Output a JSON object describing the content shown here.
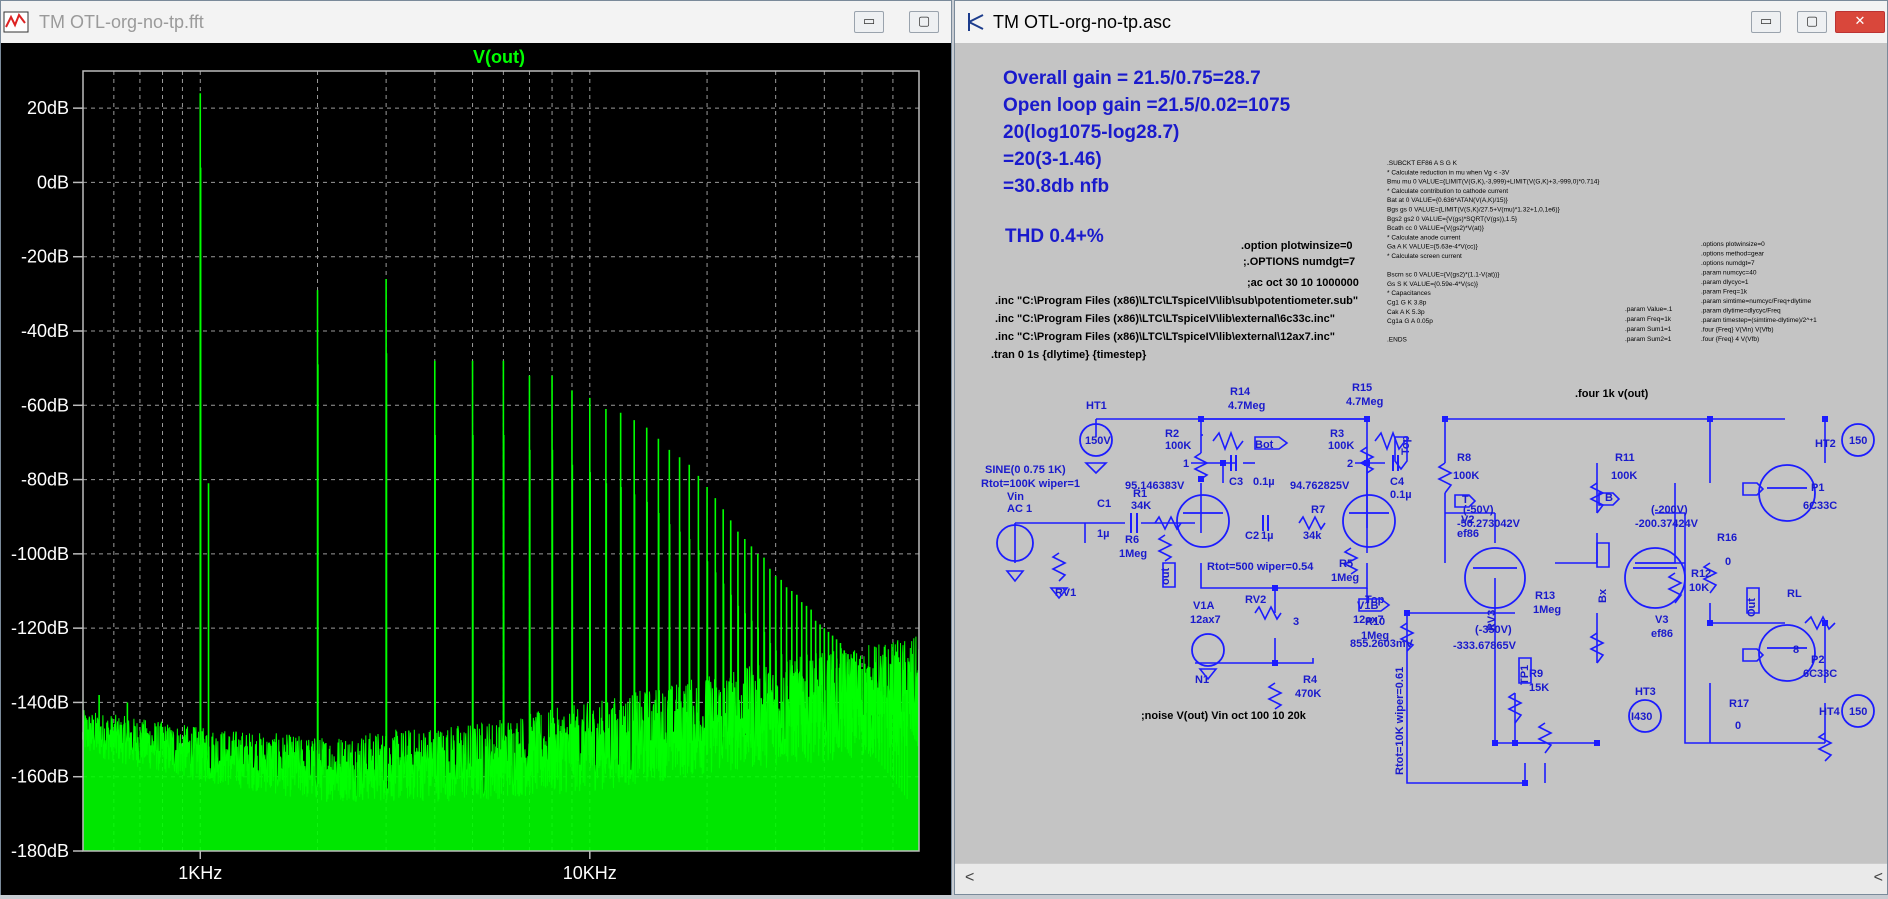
{
  "plot_window": {
    "title": "TM OTL-org-no-tp.fft",
    "buttons": {
      "minimize": "▭",
      "maximize": "▢"
    }
  },
  "schematic_window": {
    "title": "TM OTL-org-no-tp.asc",
    "buttons": {
      "minimize": "▭",
      "maximize": "▢",
      "close": "✕"
    },
    "scroll_left": "<",
    "scroll_right": "<"
  },
  "colors": {
    "trace": "#00ff00",
    "wire": "#1c1cff",
    "plot_bg": "#000000",
    "schem_bg": "#c4c4c4"
  },
  "chart_data": {
    "type": "line",
    "title": "V(out)",
    "xscale": "log",
    "xlim": [
      500,
      70000
    ],
    "ylim": [
      -180,
      30
    ],
    "grid": true,
    "ytick_labels": [
      "20dB",
      "0dB",
      "-20dB",
      "-40dB",
      "-60dB",
      "-80dB",
      "-100dB",
      "-120dB",
      "-140dB",
      "-160dB",
      "-180dB"
    ],
    "ytick_values": [
      20,
      0,
      -20,
      -40,
      -60,
      -80,
      -100,
      -120,
      -140,
      -160,
      -180
    ],
    "xtick_labels": [
      "1KHz",
      "10KHz"
    ],
    "xtick_values": [
      1000,
      10000
    ],
    "harmonics": {
      "fundamental_hz": 1000,
      "levels_db": [
        24,
        -29,
        -26,
        -48,
        -48,
        -48,
        -52,
        -52,
        -56,
        -58,
        -61,
        -62,
        -64,
        -66,
        -69,
        -72,
        -74,
        -76,
        -79,
        -82,
        -85,
        -88,
        -91,
        -94,
        -96,
        -98,
        -100,
        -101,
        -104,
        -106,
        -107,
        -109,
        -110,
        -111,
        -113,
        -114,
        -115,
        -118,
        -119,
        -120,
        -121,
        -122,
        -123,
        -124,
        -126,
        -127,
        -128,
        -129,
        -130,
        -131,
        -132,
        -133,
        -134,
        -135,
        -136,
        -137,
        -138,
        -139,
        -140,
        -141,
        -142,
        -143,
        -144,
        -145,
        -146
      ]
    },
    "spurs": [
      {
        "f": 550,
        "db": -138
      },
      {
        "f": 500,
        "db": -150
      },
      {
        "f": 650,
        "db": -140
      },
      {
        "f": 1050,
        "db": -81
      }
    ],
    "noise_floor": [
      {
        "f": 500,
        "db": -148
      },
      {
        "f": 1000,
        "db": -154
      },
      {
        "f": 2000,
        "db": -158
      },
      {
        "f": 5000,
        "db": -156
      },
      {
        "f": 10000,
        "db": -152
      },
      {
        "f": 20000,
        "db": -146
      },
      {
        "f": 40000,
        "db": -141
      },
      {
        "f": 70000,
        "db": -138
      }
    ]
  },
  "schematic": {
    "notes": {
      "gain1": "Overall gain = 21.5/0.75=28.7",
      "gain2": "Open loop gain =21.5/0.02=1075",
      "gain3": "20(log1075-log28.7)",
      "gain4": "=20(3-1.46)",
      "gain5": "=30.8db nfb",
      "thd": "THD 0.4+%"
    },
    "directives": {
      "opt1": ".option plotwinsize=0",
      "opt2": ";.OPTIONS numdgt=7",
      "ac": ";ac oct 30 10 1000000",
      "inc1": ".inc \"C:\\Program Files (x86)\\LTC\\LTspiceIV\\lib\\sub\\potentiometer.sub\"",
      "inc2": ".inc \"C:\\Program Files (x86)\\LTC\\LTspiceIV\\lib\\external\\6c33c.inc\"",
      "inc3": ".inc \"C:\\Program Files (x86)\\LTC\\LTspiceIV\\lib\\external\\12ax7.inc\"",
      "tran": ".tran 0 1s {dlytime} {timestep}",
      "four": ".four 1k v(out)",
      "noise": ";noise V(out) Vin oct 100 10 20k"
    },
    "subckt_lines": [
      ".SUBCKT EF86 A S G K",
      "* Calculate reduction in mu when Vg < -3V",
      "Bmu  mu  0  VALUE={LIMIT(V(G,K),-3,999)+LIMIT(V(G,K)+3,-999,0)*0.714}",
      "* Calculate contribution to cathode current",
      "Bat  at  0  VALUE={0.636*ATAN(V(A,K)/15)}",
      "Bgs  gs  0  VALUE={LIMIT(V(S,K)/27.5+V(mu)*1.32+1,0,1e6)}",
      "Bgs2  gs2  0  VALUE={V(gs)*SQRT(V(gs)),1.5}",
      "Bcath  cc  0  VALUE={V(gs2)*V(at)}",
      "* Calculate anode current",
      "Ga  A  K  VALUE={5.63e-4*V(cc)}",
      "* Calculate screen current",
      "",
      "Bscrn  sc  0  VALUE={V(gs2)*(1.1-V(at))}",
      "Gs  S  K  VALUE={0.59e-4*V(sc)}",
      "* Capacitances",
      "Cg1  G  K  3.8p",
      "Cak  A  K  5.3p",
      "Cg1a  G  A  0.05p",
      "",
      ".ENDS"
    ],
    "options_lines": [
      ".options plotwinsize=0",
      ".options method=gear",
      ".options numdgt=7",
      ".param numcyc=40",
      ".param dlycyc=1",
      ".param Freq=1k",
      ".param simtime=numcyc/Freq+dlytime",
      ".param dlytime=dlycyc/Freq",
      ".param timestep=(simtime-dlytime)/2^+1",
      ".four {Freq} V(Vin) V(Vfb)",
      ".four {Freq} 4 V(Vfb)"
    ],
    "param_lines": [
      ".param Value=.1",
      ".param Freq=1k",
      ".param Sum1=1",
      ".param Sum2=1"
    ],
    "labels": {
      "HT1": "HT1",
      "HT1v": "150V",
      "R2": "R2",
      "R2v": "100K",
      "R14": "R14",
      "R14v": "4.7Meg",
      "R15": "R15",
      "R15v": "4.7Meg",
      "R3": "R3",
      "R3v": "100K",
      "n1": "1",
      "n2": "2",
      "n3": "3",
      "bot": "Bot",
      "top": "Top",
      "C3": "C3",
      "C3v": "0.1µ",
      "C4": "C4",
      "C4v": "0.1µ",
      "v95": "95.146383V",
      "v94": "94.762825V",
      "sine": "SINE(0 0.75 1K)",
      "rtot1": "Rtot=100K wiper=1",
      "vin": "Vin",
      "ac1": "AC 1",
      "C1": "C1",
      "C1v": "1µ",
      "R1": "R1",
      "R1v": "34K",
      "R6": "R6",
      "R6v": "1Meg",
      "R7": "R7",
      "R7v": "34k",
      "C2": "C2",
      "C2v": "1µ",
      "R5": "R5",
      "R5v": "1Meg",
      "rtot2": "Rtot=500 wiper=0.54",
      "RV1": "RV1",
      "RV2": "RV2",
      "RV3": "RV3",
      "out": "out",
      "V1A": "V1A",
      "V1Av": "12ax7",
      "V1B": "V1B",
      "V1Bv": "12ax7",
      "R4": "R4",
      "R4v": "470K",
      "v855": "855.2603mV",
      "N1": "N1",
      "R8": "R8",
      "R8v": "100K",
      "T": "T",
      "B": "B",
      "Bx": "Bx",
      "V2": "V2",
      "V2v": "ef86",
      "m50": "(-50V)",
      "m50b": "-50.273042V",
      "R10": "R10",
      "R10v": "1Meg",
      "rtot3": "Rtot=10K wiper=0.61",
      "m350": "(-350V)",
      "m350b": "-333.67865V",
      "TP1": "TP1",
      "R13": "R13",
      "R13v": "1Meg",
      "R9": "R9",
      "R9v": "15K",
      "HT3": "HT3",
      "HT3v": "I430",
      "R11": "R11",
      "R11v": "100K",
      "V3": "V3",
      "V3v": "ef86",
      "m200": "(-200V)",
      "m200b": "-200.37424V",
      "R12": "R12",
      "R12v": "10K",
      "R16": "R16",
      "R16v": "0",
      "HT2": "HT2",
      "HT2v": "150",
      "P1": "P1",
      "P1v": "6C33C",
      "P2": "P2",
      "P2v": "6C33C",
      "out2": "Out",
      "RL": "RL",
      "RLv": "8",
      "R17": "R17",
      "R17v": "0",
      "HT4": "HT4",
      "HT4v": "150"
    }
  }
}
